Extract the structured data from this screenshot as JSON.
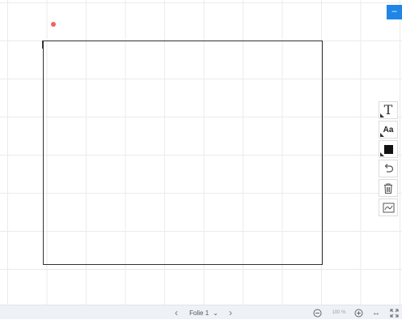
{
  "toolbar": {
    "minimize_label": "–",
    "text_tool_label": "T",
    "font_tool_label": "Aa",
    "color_swatch": "#111111"
  },
  "footer": {
    "prev_symbol": "‹",
    "slide_label": "Folie 1",
    "slide_dropdown_symbol": "⌄",
    "next_symbol": "›",
    "zoom_level": "100 %",
    "fit_width_symbol": "↔",
    "fullscreen_symbol": "⛶"
  },
  "colors": {
    "accent": "#1f86e6",
    "pointer": "#f06262",
    "grid": "#ebebeb",
    "footer_bg": "#eef1f5"
  }
}
